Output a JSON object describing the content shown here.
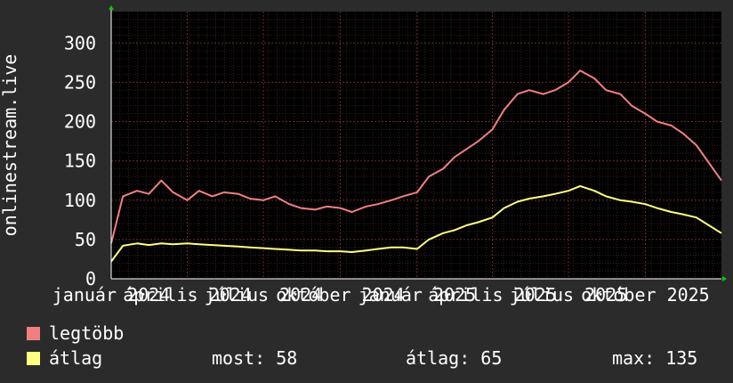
{
  "chart_data": {
    "type": "line",
    "ylabel": "onlinestream.live",
    "ylim": [
      0,
      340
    ],
    "yticks": [
      0,
      50,
      100,
      150,
      200,
      250,
      300
    ],
    "xlim": [
      "2024-01-01",
      "2025-12-31"
    ],
    "xtick_labels": [
      {
        "date": "2024-01-01",
        "label": "január 2024"
      },
      {
        "date": "2024-04-01",
        "label": "április 2024"
      },
      {
        "date": "2024-07-01",
        "label": "július 2024"
      },
      {
        "date": "2024-10-01",
        "label": "október 2024"
      },
      {
        "date": "2025-01-01",
        "label": "január 2025"
      },
      {
        "date": "2025-04-01",
        "label": "április 2025"
      },
      {
        "date": "2025-07-01",
        "label": "július 2025"
      },
      {
        "date": "2025-10-01",
        "label": "október 2025"
      }
    ],
    "grid": true,
    "series": [
      {
        "name": "legtöbb",
        "color": "#f08080",
        "points": [
          [
            "2024-01-01",
            45
          ],
          [
            "2024-01-15",
            105
          ],
          [
            "2024-02-01",
            112
          ],
          [
            "2024-02-15",
            108
          ],
          [
            "2024-03-01",
            125
          ],
          [
            "2024-03-15",
            110
          ],
          [
            "2024-04-01",
            100
          ],
          [
            "2024-04-15",
            112
          ],
          [
            "2024-05-01",
            105
          ],
          [
            "2024-05-15",
            110
          ],
          [
            "2024-06-01",
            108
          ],
          [
            "2024-06-15",
            102
          ],
          [
            "2024-07-01",
            100
          ],
          [
            "2024-07-15",
            105
          ],
          [
            "2024-08-01",
            95
          ],
          [
            "2024-08-15",
            90
          ],
          [
            "2024-09-01",
            88
          ],
          [
            "2024-09-15",
            92
          ],
          [
            "2024-10-01",
            90
          ],
          [
            "2024-10-15",
            85
          ],
          [
            "2024-11-01",
            92
          ],
          [
            "2024-11-15",
            95
          ],
          [
            "2024-12-01",
            100
          ],
          [
            "2024-12-15",
            105
          ],
          [
            "2025-01-01",
            110
          ],
          [
            "2025-01-15",
            130
          ],
          [
            "2025-02-01",
            140
          ],
          [
            "2025-02-15",
            155
          ],
          [
            "2025-03-01",
            165
          ],
          [
            "2025-03-15",
            175
          ],
          [
            "2025-04-01",
            190
          ],
          [
            "2025-04-15",
            215
          ],
          [
            "2025-05-01",
            235
          ],
          [
            "2025-05-15",
            240
          ],
          [
            "2025-06-01",
            235
          ],
          [
            "2025-06-15",
            240
          ],
          [
            "2025-07-01",
            250
          ],
          [
            "2025-07-15",
            265
          ],
          [
            "2025-08-01",
            255
          ],
          [
            "2025-08-15",
            240
          ],
          [
            "2025-09-01",
            235
          ],
          [
            "2025-09-15",
            220
          ],
          [
            "2025-10-01",
            210
          ],
          [
            "2025-10-15",
            200
          ],
          [
            "2025-11-01",
            195
          ],
          [
            "2025-11-15",
            185
          ],
          [
            "2025-12-01",
            170
          ],
          [
            "2025-12-31",
            125
          ]
        ]
      },
      {
        "name": "átlag",
        "color": "#ffff80",
        "points": [
          [
            "2024-01-01",
            22
          ],
          [
            "2024-01-15",
            42
          ],
          [
            "2024-02-01",
            45
          ],
          [
            "2024-02-15",
            43
          ],
          [
            "2024-03-01",
            45
          ],
          [
            "2024-03-15",
            44
          ],
          [
            "2024-04-01",
            45
          ],
          [
            "2024-04-15",
            44
          ],
          [
            "2024-05-01",
            43
          ],
          [
            "2024-05-15",
            42
          ],
          [
            "2024-06-01",
            41
          ],
          [
            "2024-06-15",
            40
          ],
          [
            "2024-07-01",
            39
          ],
          [
            "2024-07-15",
            38
          ],
          [
            "2024-08-01",
            37
          ],
          [
            "2024-08-15",
            36
          ],
          [
            "2024-09-01",
            36
          ],
          [
            "2024-09-15",
            35
          ],
          [
            "2024-10-01",
            35
          ],
          [
            "2024-10-15",
            34
          ],
          [
            "2024-11-01",
            36
          ],
          [
            "2024-11-15",
            38
          ],
          [
            "2024-12-01",
            40
          ],
          [
            "2024-12-15",
            40
          ],
          [
            "2025-01-01",
            38
          ],
          [
            "2025-01-15",
            50
          ],
          [
            "2025-02-01",
            58
          ],
          [
            "2025-02-15",
            62
          ],
          [
            "2025-03-01",
            68
          ],
          [
            "2025-03-15",
            72
          ],
          [
            "2025-04-01",
            78
          ],
          [
            "2025-04-15",
            90
          ],
          [
            "2025-05-01",
            98
          ],
          [
            "2025-05-15",
            102
          ],
          [
            "2025-06-01",
            105
          ],
          [
            "2025-06-15",
            108
          ],
          [
            "2025-07-01",
            112
          ],
          [
            "2025-07-15",
            118
          ],
          [
            "2025-08-01",
            112
          ],
          [
            "2025-08-15",
            105
          ],
          [
            "2025-09-01",
            100
          ],
          [
            "2025-09-15",
            98
          ],
          [
            "2025-10-01",
            95
          ],
          [
            "2025-10-15",
            90
          ],
          [
            "2025-11-01",
            85
          ],
          [
            "2025-11-15",
            82
          ],
          [
            "2025-12-01",
            78
          ],
          [
            "2025-12-31",
            58
          ]
        ]
      }
    ]
  },
  "legend": {
    "max_label": "legtöbb",
    "max_color": "#f08080",
    "avg_label": "átlag",
    "avg_color": "#ffff80",
    "current": "most: 58",
    "average": "átlag: 65",
    "maximum": "max: 135"
  }
}
